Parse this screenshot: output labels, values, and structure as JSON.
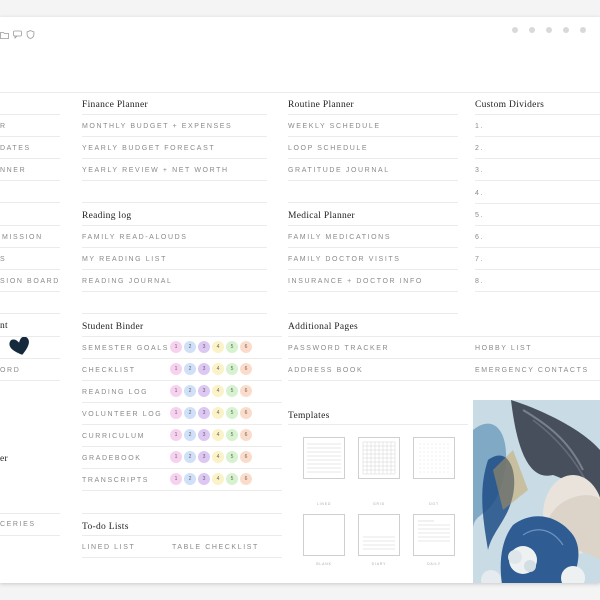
{
  "toolbar": {
    "icons": [
      "folder-icon",
      "chat-icon",
      "shield-icon"
    ]
  },
  "col0": {
    "items_top": [
      "R",
      "DATES",
      "NNER"
    ],
    "items_mid": [
      "MISSION",
      "S",
      "SION BOARD"
    ],
    "heading_nt": "nt",
    "item_ord": "ORD",
    "heading_er": "er",
    "item_ceries": "CERIES"
  },
  "finance": {
    "title": "Finance Planner",
    "items": [
      "MONTHLY BUDGET + EXPENSES",
      "YEARLY BUDGET FORECAST",
      "YEARLY REVIEW + NET WORTH"
    ]
  },
  "routine": {
    "title": "Routine Planner",
    "items": [
      "WEEKLY SCHEDULE",
      "LOOP SCHEDULE",
      "GRATITUDE JOURNAL"
    ]
  },
  "dividers": {
    "title": "Custom Dividers",
    "items": [
      "1.",
      "2.",
      "3.",
      "4.",
      "5.",
      "6.",
      "7.",
      "8."
    ]
  },
  "reading": {
    "title": "Reading log",
    "items": [
      "FAMILY READ-ALOUDS",
      "MY READING LIST",
      "READING JOURNAL"
    ]
  },
  "medical": {
    "title": "Medical Planner",
    "items": [
      "FAMILY MEDICATIONS",
      "FAMILY DOCTOR VISITS",
      "INSURANCE + DOCTOR INFO"
    ]
  },
  "student": {
    "title": "Student Binder",
    "items": [
      "SEMESTER GOALS",
      "CHECKLIST",
      "READING LOG",
      "VOLUNTEER LOG",
      "CURRICULUM",
      "GRADEBOOK",
      "TRANSCRIPTS"
    ]
  },
  "bubble_numbers": [
    "1",
    "2",
    "3",
    "4",
    "5",
    "6"
  ],
  "bubble_colors": [
    "#f6d2ee",
    "#cfe0f8",
    "#dcc8f3",
    "#fbf2c8",
    "#d6f2cf",
    "#fbdccb"
  ],
  "additional": {
    "title": "Additional Pages",
    "items": [
      "PASSWORD TRACKER",
      "ADDRESS BOOK"
    ]
  },
  "additional_right": [
    "HOBBY LIST",
    "EMERGENCY CONTACTS"
  ],
  "templates": {
    "title": "Templates",
    "labels": [
      "LINED",
      "GRID",
      "DOT",
      "BLANK",
      "DIARY",
      "DAILY"
    ]
  },
  "todo": {
    "title": "To-do Lists",
    "items": [
      "LINED LIST",
      "TABLE CHECKLIST"
    ]
  }
}
